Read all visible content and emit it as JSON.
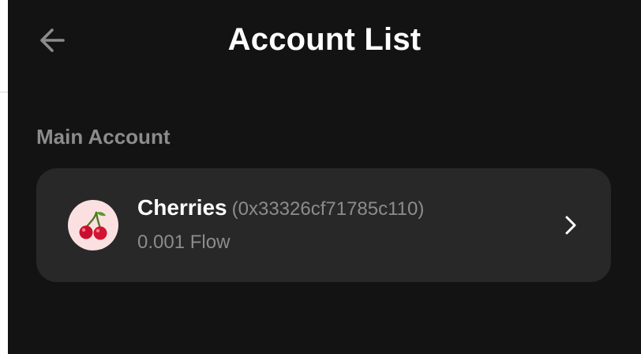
{
  "header": {
    "title": "Account List",
    "back_icon": "arrow-left-icon"
  },
  "section": {
    "label": "Main Account"
  },
  "account": {
    "name": "Cherries",
    "address": "(0x33326cf71785c110)",
    "balance": "0.001 Flow",
    "avatar_icon": "cherries-icon",
    "chevron_icon": "chevron-right-icon"
  },
  "colors": {
    "background": "#131313",
    "card": "#282828",
    "muted_text": "#8c8c8c",
    "avatar_bg": "#fbe0e2"
  }
}
